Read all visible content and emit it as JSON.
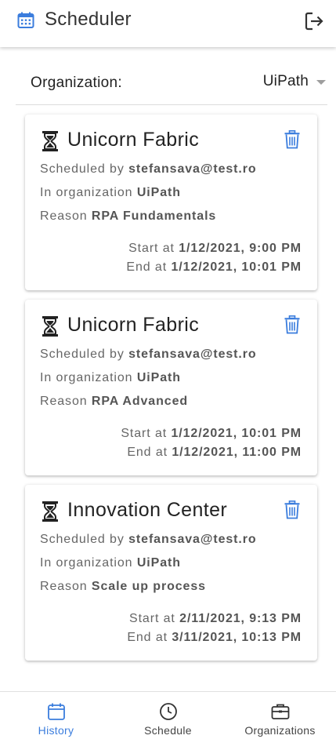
{
  "app": {
    "title": "Scheduler"
  },
  "organization": {
    "label": "Organization:",
    "selected": "UiPath"
  },
  "bookings": [
    {
      "room": "Unicorn Fabric",
      "scheduled_by_label": "Scheduled by",
      "scheduled_by": "stefansava@test.ro",
      "org_label": "In organization",
      "org": "UiPath",
      "reason_label": "Reason",
      "reason": "RPA Fundamentals",
      "start_label": "Start at",
      "start": "1/12/2021, 9:00 PM",
      "end_label": "End at",
      "end": "1/12/2021, 10:01 PM"
    },
    {
      "room": "Unicorn Fabric",
      "scheduled_by_label": "Scheduled by",
      "scheduled_by": "stefansava@test.ro",
      "org_label": "In organization",
      "org": "UiPath",
      "reason_label": "Reason",
      "reason": "RPA Advanced",
      "start_label": "Start at",
      "start": "1/12/2021, 10:01 PM",
      "end_label": "End at",
      "end": "1/12/2021, 11:00 PM"
    },
    {
      "room": "Innovation Center",
      "scheduled_by_label": "Scheduled by",
      "scheduled_by": "stefansava@test.ro",
      "org_label": "In organization",
      "org": "UiPath",
      "reason_label": "Reason",
      "reason": "Scale up process",
      "start_label": "Start at",
      "start": "2/11/2021, 9:13 PM",
      "end_label": "End at",
      "end": "3/11/2021, 10:13 PM"
    }
  ],
  "nav": [
    {
      "label": "History",
      "icon": "calendar-icon",
      "active": true
    },
    {
      "label": "Schedule",
      "icon": "clock-icon",
      "active": false
    },
    {
      "label": "Organizations",
      "icon": "briefcase-icon",
      "active": false
    }
  ],
  "colors": {
    "accent": "#3b7ddd",
    "text": "#222222",
    "muted": "#666666",
    "trash": "#3b7ddd"
  }
}
